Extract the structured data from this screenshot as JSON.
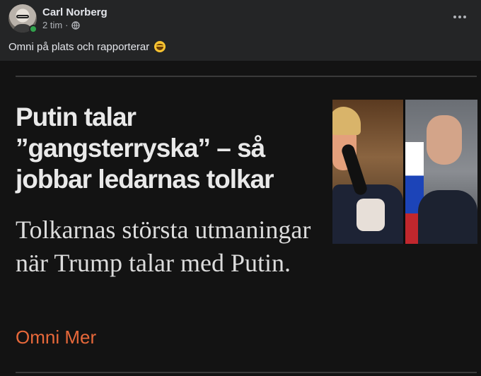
{
  "post": {
    "author": "Carl Norberg",
    "time": "2 tim",
    "separator": "·",
    "audience_icon": "globe-icon",
    "caption": "Omni på plats och rapporterar",
    "emoji": "grinning-face-emoji",
    "more_icon": "more-horizontal-icon",
    "online": true
  },
  "article": {
    "headline": "Putin talar ”gangsterryska” – så jobbar ledarnas tolkar",
    "subheadline": "Tolkarnas största utmaningar när Trump talar med Putin.",
    "brand": "Omni Mer"
  },
  "colors": {
    "background": "#242526",
    "media_background": "#131313",
    "brand_accent": "#e7683a",
    "online_dot": "#31a24c",
    "text_primary": "#e4e6eb",
    "text_secondary": "#b0b3b8"
  }
}
